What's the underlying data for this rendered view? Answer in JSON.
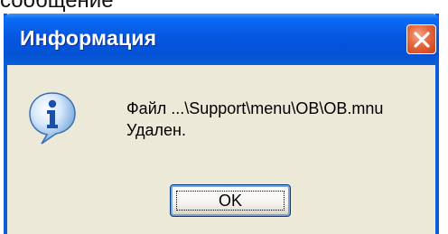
{
  "background_caption": "сообщение",
  "dialog": {
    "title": "Информация",
    "close_icon": "close-x-icon",
    "icon": "information-icon",
    "message_line1": "Файл ...\\Support\\menu\\OB\\OB.mnu",
    "message_line2": "Удален.",
    "ok_label": "OK"
  },
  "colors": {
    "titlebar": "#0556e0",
    "dialog_bg": "#ece9d8",
    "close_button": "#e5653c"
  }
}
